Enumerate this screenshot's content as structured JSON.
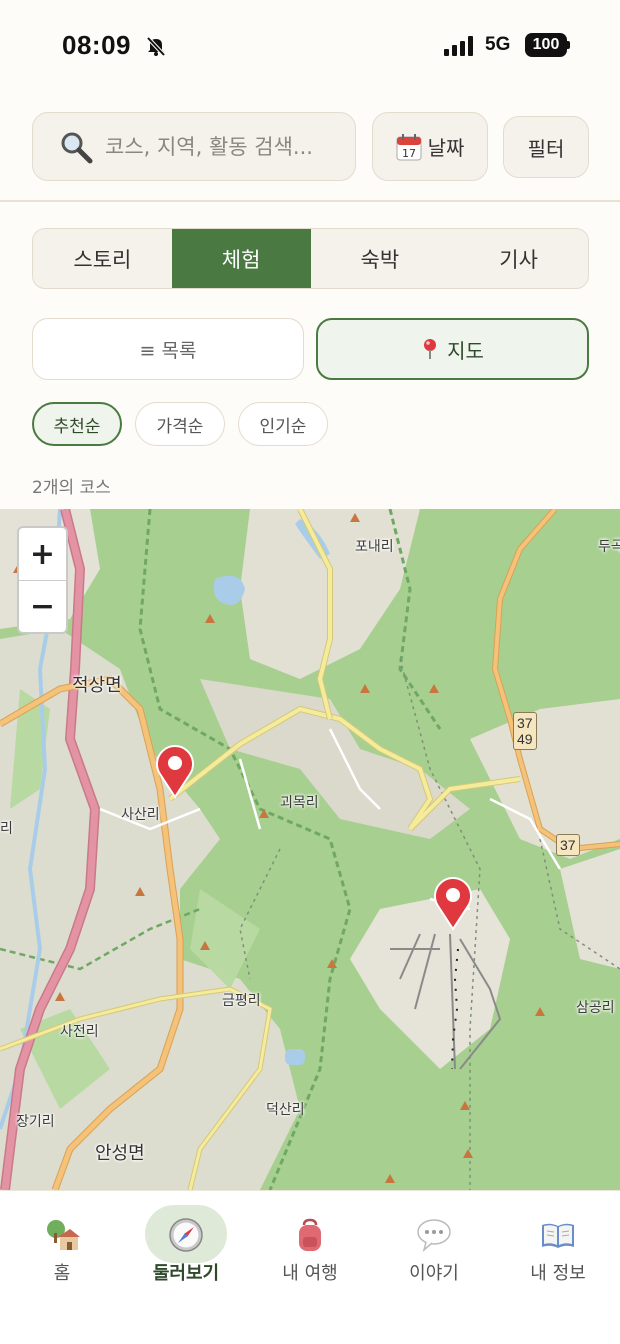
{
  "status_bar": {
    "time": "08:09",
    "network": "5G",
    "battery": "100"
  },
  "search": {
    "placeholder": "코스, 지역, 활동 검색..."
  },
  "date_button": {
    "label": "날짜",
    "icon": "calendar-icon"
  },
  "filter_button": {
    "label": "필터"
  },
  "category_tabs": [
    {
      "label": "스토리",
      "active": false
    },
    {
      "label": "체험",
      "active": true
    },
    {
      "label": "숙박",
      "active": false
    },
    {
      "label": "기사",
      "active": false
    }
  ],
  "view_toggle": {
    "list_label": "≡ 목록",
    "map_label": "지도",
    "active": "map"
  },
  "sort_chips": [
    {
      "label": "추천순",
      "active": true
    },
    {
      "label": "가격순",
      "active": false
    },
    {
      "label": "인기순",
      "active": false
    }
  ],
  "result_count": "2개의 코스",
  "map": {
    "zoom_in": "+",
    "zoom_out": "−",
    "places": [
      "포내리",
      "두곡",
      "적상면",
      "사산리",
      "괴목리",
      "금평리",
      "사전리",
      "장기리",
      "안성면",
      "덕산리",
      "삼공리",
      "리"
    ],
    "route_shields": [
      "37",
      "49",
      "37"
    ],
    "markers": 2
  },
  "bottom_nav": [
    {
      "label": "홈",
      "icon": "home-icon",
      "active": false
    },
    {
      "label": "둘러보기",
      "icon": "compass-icon",
      "active": true
    },
    {
      "label": "내 여행",
      "icon": "backpack-icon",
      "active": false
    },
    {
      "label": "이야기",
      "icon": "speech-bubble-icon",
      "active": false
    },
    {
      "label": "내 정보",
      "icon": "book-icon",
      "active": false
    }
  ],
  "colors": {
    "accent": "#4a7a42",
    "background": "#fdfcf8",
    "map_forest": "#a7cf90",
    "marker": "#e0383f"
  }
}
